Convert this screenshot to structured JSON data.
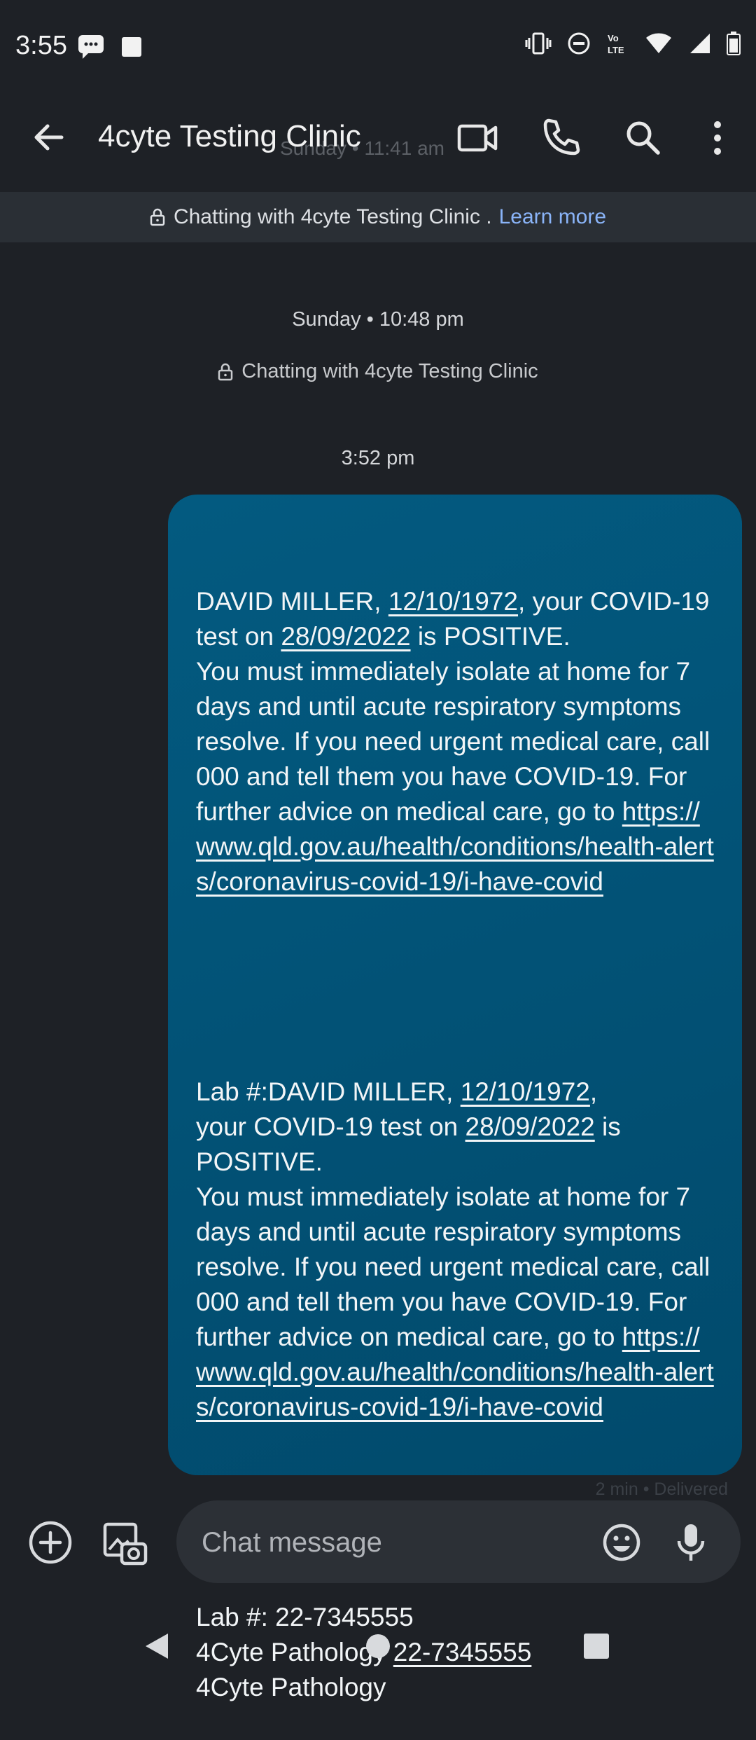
{
  "status_bar": {
    "time": "3:55",
    "icons": [
      "messages-notification-icon",
      "app-notification-icon",
      "vibrate-icon",
      "do-not-disturb-icon",
      "volte-icon",
      "wifi-icon",
      "signal-icon",
      "battery-icon"
    ]
  },
  "app_bar": {
    "title": "4cyte Testing Clinic",
    "faded_overlap": "Sunday • 11:41 am",
    "icons": [
      "back-arrow-icon",
      "video-call-icon",
      "phone-icon",
      "search-icon",
      "more-options-icon"
    ]
  },
  "banner": {
    "text": "Chatting with 4cyte Testing Clinic .",
    "link": "Learn more"
  },
  "conversation": {
    "day_stamp": "Sunday • 10:48 pm",
    "chatting_note": "Chatting with 4cyte Testing Clinic",
    "message_time": "3:52 pm",
    "message": {
      "p1": {
        "a": "DAVID MILLER, ",
        "dob": "12/10/1972",
        "b": ", your COVID-19 test on ",
        "date": "28/09/2022",
        "c": " is POSITIVE.\nYou must immediately isolate at home for 7 days and until acute respiratory symptoms resolve. If you need urgent medical care, call 000 and tell them you have COVID-19. For further advice on medical care, go to ",
        "url": "https://www.qld.gov.au/health/conditions/health-alerts/coronavirus-covid-19/i-have-covid"
      },
      "p2": {
        "a": "Lab #:DAVID MILLER, ",
        "dob": "12/10/1972",
        "b": ",\nyour COVID-19 test on ",
        "date": "28/09/2022",
        "c": " is POSITIVE.\nYou must immediately isolate at home for 7 days and until acute respiratory symptoms resolve. If you need urgent medical care, call 000 and tell them you have COVID-19. For further advice on medical care, go to ",
        "url": "https://www.qld.gov.au/health/conditions/health-alerts/coronavirus-covid-19/i-have-covid"
      },
      "p3": {
        "line1": "Lab #: 22-7345555",
        "line2a": "4Cyte Pathology ",
        "lab_no": "22-7345555",
        "line3": "4Cyte Pathology"
      }
    },
    "delivery_status": "2 min • Delivered"
  },
  "composer": {
    "placeholder": "Chat message",
    "icons": [
      "add-icon",
      "gallery-icon",
      "emoji-icon",
      "mic-icon"
    ]
  },
  "nav_bar": {
    "icons": [
      "nav-back-icon",
      "nav-home-icon",
      "nav-recents-icon"
    ]
  }
}
